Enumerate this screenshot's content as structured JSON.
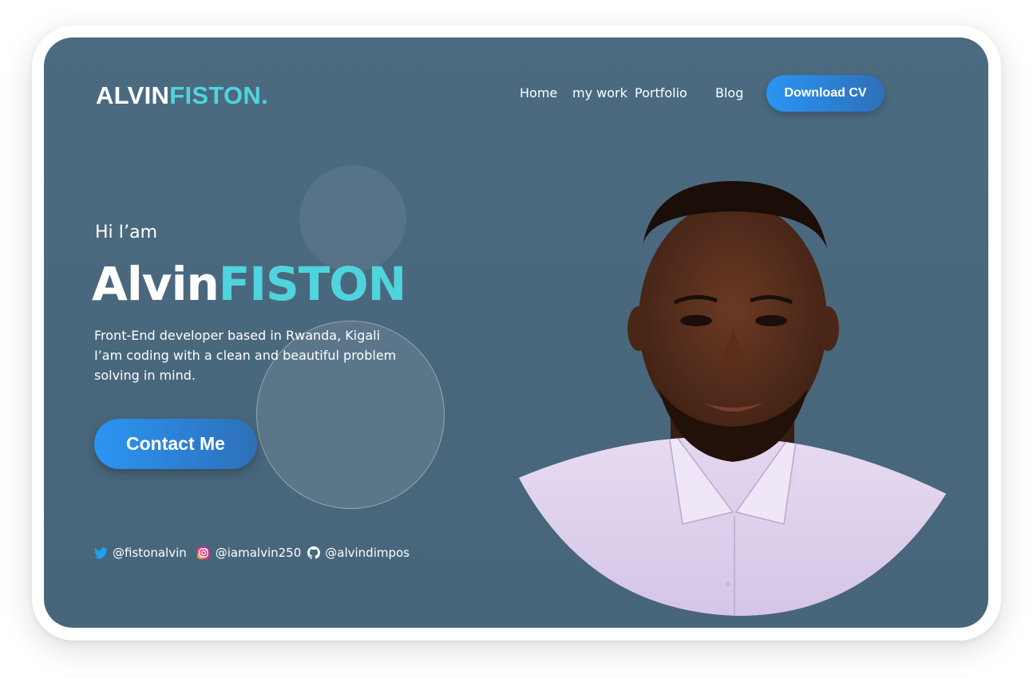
{
  "header": {
    "logo_primary": "ALVIN",
    "logo_accent": "FISTON.",
    "nav": [
      {
        "label": "Home"
      },
      {
        "label": "my work"
      },
      {
        "label": "Portfolio"
      },
      {
        "label": "Blog"
      }
    ],
    "cta_label": "Download CV"
  },
  "hero": {
    "greeting": "Hi I’am",
    "name_primary": "Alvin",
    "name_accent": "FISTON",
    "bio_lines": [
      "Front-End developer based in Rwanda, Kigali",
      "I’am coding with a clean and beautiful problem",
      "solving in mind."
    ],
    "contact_label": "Contact Me"
  },
  "socials": [
    {
      "platform": "twitter",
      "icon": "twitter-icon",
      "handle": "@fistonalvin"
    },
    {
      "platform": "instagram",
      "icon": "instagram-icon",
      "handle": "@iamalvin250"
    },
    {
      "platform": "github",
      "icon": "github-icon",
      "handle": "@alvindimpos"
    }
  ],
  "colors": {
    "background": "#4b6b80",
    "accent": "#4fd4de",
    "button_start": "#2a95f3",
    "button_end": "#2e6fb8"
  }
}
